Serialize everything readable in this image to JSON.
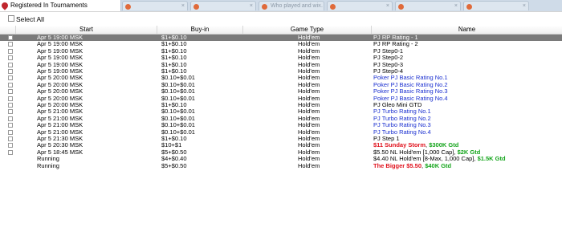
{
  "window": {
    "title": "Registered In Tournaments",
    "background_tabs": [
      {
        "label": ""
      },
      {
        "label": ""
      },
      {
        "label": "Who played and wi..."
      },
      {
        "label": ""
      },
      {
        "label": ""
      },
      {
        "label": ""
      }
    ]
  },
  "toolbar": {
    "select_all_label": "Select All"
  },
  "table": {
    "columns": [
      "Start",
      "Buy-in",
      "Game Type",
      "Name"
    ],
    "rows": [
      {
        "checkbox": true,
        "start": "Apr 5  19:00 MSK",
        "buyin": "$1+$0.10",
        "game": "Hold'em",
        "name": [
          {
            "text": "PJ RP Rating - 1",
            "color": "black"
          }
        ],
        "selected": true
      },
      {
        "checkbox": true,
        "start": "Apr 5  19:00 MSK",
        "buyin": "$1+$0.10",
        "game": "Hold'em",
        "name": [
          {
            "text": "PJ RP Rating - 2",
            "color": "black"
          }
        ]
      },
      {
        "checkbox": true,
        "start": "Apr 5  19:00 MSK",
        "buyin": "$1+$0.10",
        "game": "Hold'em",
        "name": [
          {
            "text": "PJ Step0-1",
            "color": "black"
          }
        ]
      },
      {
        "checkbox": true,
        "start": "Apr 5  19:00 MSK",
        "buyin": "$1+$0.10",
        "game": "Hold'em",
        "name": [
          {
            "text": "PJ Step0-2",
            "color": "black"
          }
        ]
      },
      {
        "checkbox": true,
        "start": "Apr 5  19:00 MSK",
        "buyin": "$1+$0.10",
        "game": "Hold'em",
        "name": [
          {
            "text": "PJ Step0-3",
            "color": "black"
          }
        ]
      },
      {
        "checkbox": true,
        "start": "Apr 5  19:00 MSK",
        "buyin": "$1+$0.10",
        "game": "Hold'em",
        "name": [
          {
            "text": "PJ Step0-4",
            "color": "black"
          }
        ]
      },
      {
        "checkbox": true,
        "start": "Apr 5  20:00 MSK",
        "buyin": "$0.10+$0.01",
        "game": "Hold'em",
        "name": [
          {
            "text": "Poker PJ Basic Rating No.1",
            "color": "blue"
          }
        ]
      },
      {
        "checkbox": true,
        "start": "Apr 5  20:00 MSK",
        "buyin": "$0.10+$0.01",
        "game": "Hold'em",
        "name": [
          {
            "text": "Poker PJ Basic Rating No.2",
            "color": "blue"
          }
        ]
      },
      {
        "checkbox": true,
        "start": "Apr 5  20:00 MSK",
        "buyin": "$0.10+$0.01",
        "game": "Hold'em",
        "name": [
          {
            "text": "Poker PJ Basic Rating No.3",
            "color": "blue"
          }
        ]
      },
      {
        "checkbox": true,
        "start": "Apr 5  20:00 MSK",
        "buyin": "$0.10+$0.01",
        "game": "Hold'em",
        "name": [
          {
            "text": "Poker PJ Basic Rating No.4",
            "color": "blue"
          }
        ]
      },
      {
        "checkbox": true,
        "start": "Apr 5  20:00 MSK",
        "buyin": "$1+$0.10",
        "game": "Hold'em",
        "name": [
          {
            "text": "PJ Gleo Mini GTD",
            "color": "black"
          }
        ]
      },
      {
        "checkbox": true,
        "start": "Apr 5  21:00 MSK",
        "buyin": "$0.10+$0.01",
        "game": "Hold'em",
        "name": [
          {
            "text": "PJ Turbo Rating No.1",
            "color": "blue"
          }
        ]
      },
      {
        "checkbox": true,
        "start": "Apr 5  21:00 MSK",
        "buyin": "$0.10+$0.01",
        "game": "Hold'em",
        "name": [
          {
            "text": "PJ Turbo Rating No.2",
            "color": "blue"
          }
        ]
      },
      {
        "checkbox": true,
        "start": "Apr 5  21:00 MSK",
        "buyin": "$0.10+$0.01",
        "game": "Hold'em",
        "name": [
          {
            "text": "PJ Turbo Rating No.3",
            "color": "blue"
          }
        ]
      },
      {
        "checkbox": true,
        "start": "Apr 5  21:00 MSK",
        "buyin": "$0.10+$0.01",
        "game": "Hold'em",
        "name": [
          {
            "text": "PJ Turbo Rating No.4",
            "color": "blue"
          }
        ]
      },
      {
        "checkbox": true,
        "start": "Apr 5  21:30 MSK",
        "buyin": "$1+$0.10",
        "game": "Hold'em",
        "name": [
          {
            "text": "PJ Step 1",
            "color": "black"
          }
        ]
      },
      {
        "checkbox": true,
        "start": "Apr 5  20:30 MSK",
        "buyin": "$10+$1",
        "game": "Hold'em",
        "name": [
          {
            "text": "$11 Sunday Storm",
            "color": "red"
          },
          {
            "text": ", ",
            "color": "black"
          },
          {
            "text": "$300K Gtd",
            "color": "green"
          }
        ]
      },
      {
        "checkbox": true,
        "start": "Apr 5  18:45 MSK",
        "buyin": "$5+$0.50",
        "game": "Hold'em",
        "name": [
          {
            "text": "$5.50 NL Hold'em [1,000 Cap], ",
            "color": "black"
          },
          {
            "text": "$2K Gtd",
            "color": "green"
          }
        ]
      },
      {
        "checkbox": false,
        "start": "Running",
        "buyin": "$4+$0.40",
        "game": "Hold'em",
        "name": [
          {
            "text": "$4.40 NL Hold'em [8-Max, 1,000 Cap], ",
            "color": "black"
          },
          {
            "text": "$1.5K Gtd",
            "color": "green"
          }
        ]
      },
      {
        "checkbox": false,
        "start": "Running",
        "buyin": "$5+$0.50",
        "game": "Hold'em",
        "name": [
          {
            "text": "The Bigger $5.50",
            "color": "red"
          },
          {
            "text": ", ",
            "color": "black"
          },
          {
            "text": "$40K Gtd",
            "color": "green"
          }
        ]
      }
    ]
  },
  "colors": {
    "selected_row": "#7a7a7a",
    "blue_text": "#1a2fd0",
    "red_text": "#e0101b",
    "green_text": "#13a41a"
  }
}
